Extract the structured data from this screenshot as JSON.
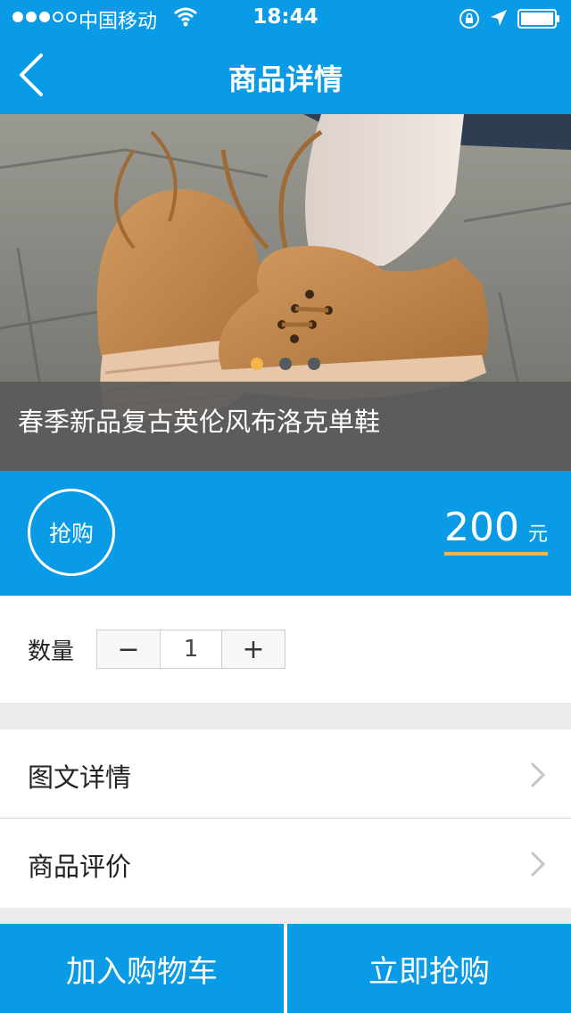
{
  "status_bar": {
    "carrier": "中国移动",
    "time": "18:44"
  },
  "nav": {
    "title": "商品详情"
  },
  "product": {
    "name": "春季新品复古英伦风布洛克单鞋",
    "carousel_pages": 3,
    "carousel_active_index": 0,
    "price_amount": "200",
    "price_unit": "元",
    "grab_badge": "抢购"
  },
  "quantity": {
    "label": "数量",
    "minus": "−",
    "value": "1",
    "plus": "+"
  },
  "details": {
    "items": [
      {
        "label": "图文详情"
      },
      {
        "label": "商品评价"
      }
    ]
  },
  "actions": {
    "add_to_cart": "加入购物车",
    "buy_now": "立即抢购"
  },
  "colors": {
    "primary": "#0a9be6",
    "accent": "#f4b548"
  }
}
